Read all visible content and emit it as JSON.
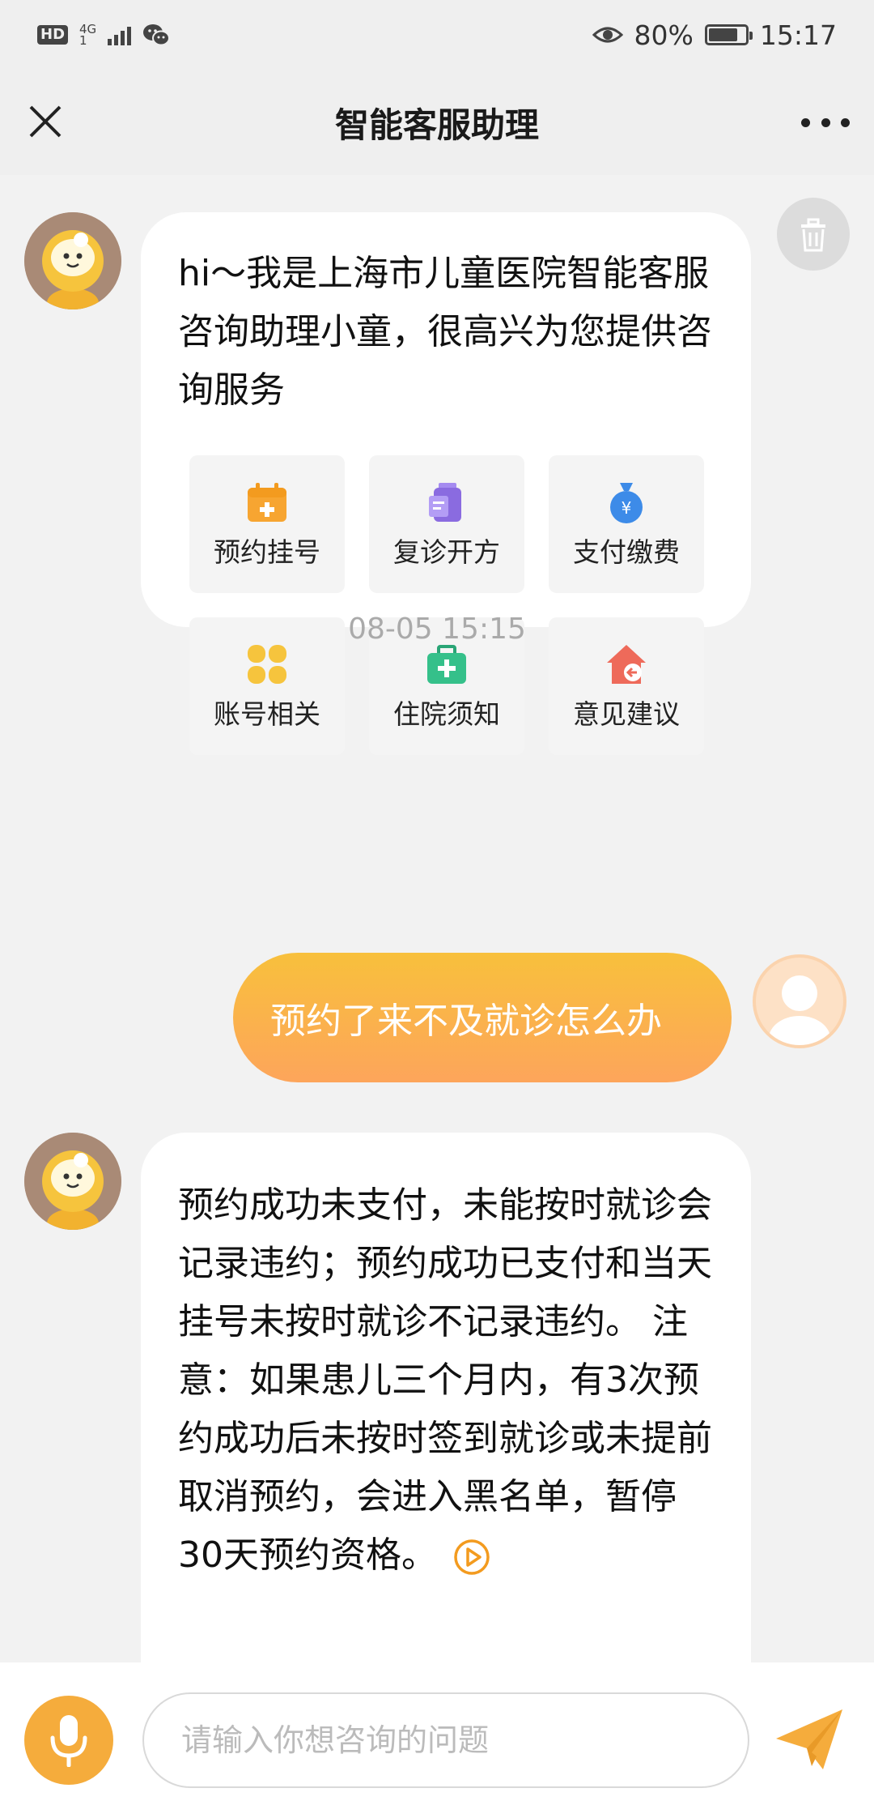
{
  "status_bar": {
    "hd": "HD",
    "network": "4G",
    "network_sub": "1",
    "battery_percent": "80%",
    "battery_level": 0.8,
    "time": "15:17"
  },
  "nav": {
    "title": "智能客服助理"
  },
  "messages": [
    {
      "role": "bot",
      "text": "hi～我是上海市儿童医院智能客服咨询助理小童，很高兴为您提供咨询服务",
      "quick_actions": [
        {
          "label": "预约挂号",
          "icon": "calendar-plus-icon",
          "color": "#f7a531"
        },
        {
          "label": "复诊开方",
          "icon": "prescription-icon",
          "color": "#8a6be0"
        },
        {
          "label": "支付缴费",
          "icon": "money-bag-icon",
          "color": "#3d8be8"
        },
        {
          "label": "账号相关",
          "icon": "clover-icon",
          "color": "#f6c43d"
        },
        {
          "label": "住院须知",
          "icon": "medical-kit-icon",
          "color": "#35c08a"
        },
        {
          "label": "意见建议",
          "icon": "feedback-house-icon",
          "color": "#ee6a5a"
        }
      ]
    },
    {
      "role": "timestamp",
      "text": "08-05 15:15"
    },
    {
      "role": "user",
      "text": "预约了来不及就诊怎么办"
    },
    {
      "role": "bot",
      "text": "预约成功未支付，未能按时就诊会记录违约；预约成功已支付和当天挂号未按时就诊不记录违约。 注意：如果患儿三个月内，有3次预约成功后未按时签到就诊或未提前取消预约，会进入黑名单，暂停30天预约资格。"
    }
  ],
  "input": {
    "placeholder": "请输入你想咨询的问题",
    "value": ""
  },
  "colors": {
    "accent": "#f5ac3c",
    "user_bubble_top": "#f8c03c",
    "user_bubble_bottom": "#fda55b"
  }
}
